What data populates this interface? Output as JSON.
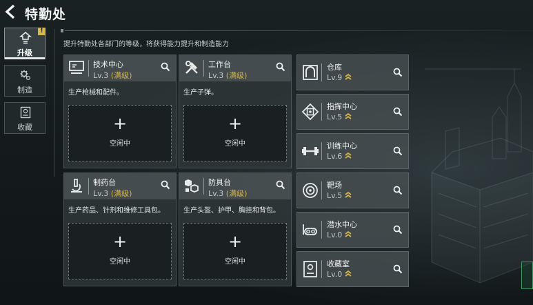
{
  "header": {
    "title": "特勤处"
  },
  "side_tabs": [
    {
      "label": "升级",
      "icon": "upgrade-icon",
      "badge": "!"
    },
    {
      "label": "制造",
      "icon": "gear-icon"
    },
    {
      "label": "收藏",
      "icon": "collection-icon"
    }
  ],
  "subtitle": "提升特勤处各部门的等级，将获得能力提升和制造能力",
  "cards": [
    {
      "name": "技术中心",
      "level": "Lv.3",
      "max": "(满级)",
      "desc": "生产枪械和配件。",
      "slot_plus": "+",
      "slot_label": "空闲中",
      "icon": "computer-icon"
    },
    {
      "name": "工作台",
      "level": "Lv.3",
      "max": "(满级)",
      "desc": "生产子弹。",
      "slot_plus": "+",
      "slot_label": "空闲中",
      "icon": "tools-icon"
    },
    {
      "name": "制药台",
      "level": "Lv.3",
      "max": "(满级)",
      "desc": "生产药品、针剂和维修工具包。",
      "slot_plus": "+",
      "slot_label": "空闲中",
      "icon": "microscope-icon"
    },
    {
      "name": "防具台",
      "level": "Lv.3",
      "max": "(满级)",
      "desc": "生产头盔、护甲、胸挂和背包。",
      "slot_plus": "+",
      "slot_label": "空闲中",
      "icon": "armor-icon"
    }
  ],
  "facilities": [
    {
      "name": "仓库",
      "level": "Lv.9",
      "icon": "warehouse-icon"
    },
    {
      "name": "指挥中心",
      "level": "Lv.5",
      "icon": "command-chip-icon"
    },
    {
      "name": "训练中心",
      "level": "Lv.6",
      "icon": "dumbbell-icon"
    },
    {
      "name": "靶场",
      "level": "Lv.5",
      "icon": "target-icon"
    },
    {
      "name": "潜水中心",
      "level": "Lv.0",
      "icon": "diving-mask-icon"
    },
    {
      "name": "收藏室",
      "level": "Lv.0",
      "icon": "collection-room-icon"
    }
  ],
  "colors": {
    "max_level": "#d6b54a",
    "upgrade_chevron": "#d6b54a",
    "badge": "#d8b84a"
  }
}
